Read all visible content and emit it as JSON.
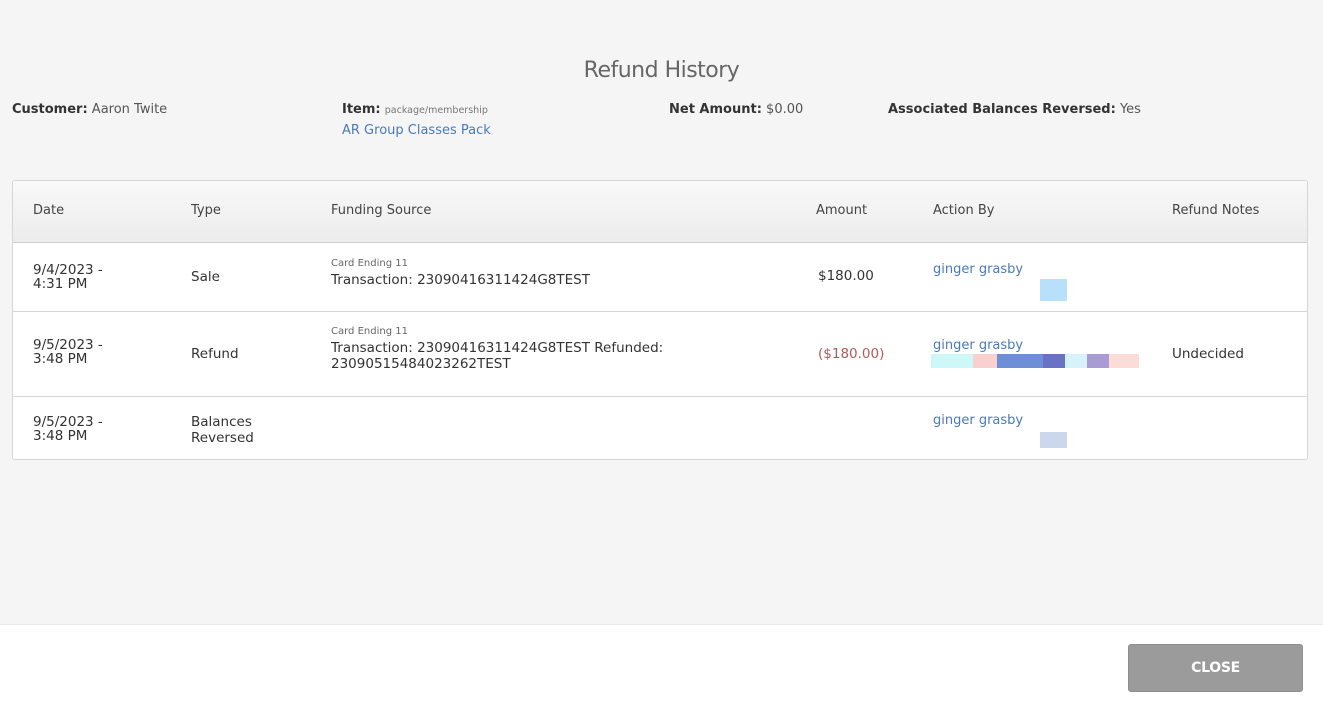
{
  "dialog": {
    "title": "Refund History"
  },
  "meta": {
    "customer_label": "Customer:",
    "customer_value": "Aaron Twite",
    "item_label": "Item:",
    "item_type": "package/membership",
    "item_link": "AR Group Classes Pack",
    "net_label": "Net Amount:",
    "net_value": "$0.00",
    "assoc_label": "Associated Balances Reversed:",
    "assoc_value": "Yes"
  },
  "table": {
    "headers": [
      "Date",
      "Type",
      "Funding Source",
      "Amount",
      "Action By",
      "Refund Notes"
    ],
    "rows": [
      {
        "date_line1": "9/4/2023 -",
        "date_line2": "4:31 PM",
        "type_line1": "Sale",
        "type_line2": "",
        "card": "Card Ending 11",
        "transaction_line1": "Transaction: 23090416311424G8TEST",
        "transaction_line2": "",
        "amount": "$180.00",
        "action_by": "ginger grasby",
        "notes": ""
      },
      {
        "date_line1": "9/5/2023 -",
        "date_line2": "3:48 PM",
        "type_line1": "Refund",
        "type_line2": "",
        "card": "Card Ending 11",
        "transaction_line1": "Transaction: 23090416311424G8TEST Refunded:",
        "transaction_line2": "23090515484023262TEST",
        "amount": "($180.00)",
        "action_by": "ginger grasby",
        "notes": "Undecided"
      },
      {
        "date_line1": "9/5/2023 -",
        "date_line2": "3:48 PM",
        "type_line1": "Balances",
        "type_line2": "Reversed",
        "card": "",
        "transaction_line1": "",
        "transaction_line2": "",
        "amount": "",
        "action_by": "ginger grasby",
        "notes": ""
      }
    ]
  },
  "footer": {
    "close_label": "CLOSE"
  },
  "colors": {
    "link": "#4a7ab8",
    "negative_amount": "#b05a5a",
    "close_button": "#9b9b9b"
  }
}
